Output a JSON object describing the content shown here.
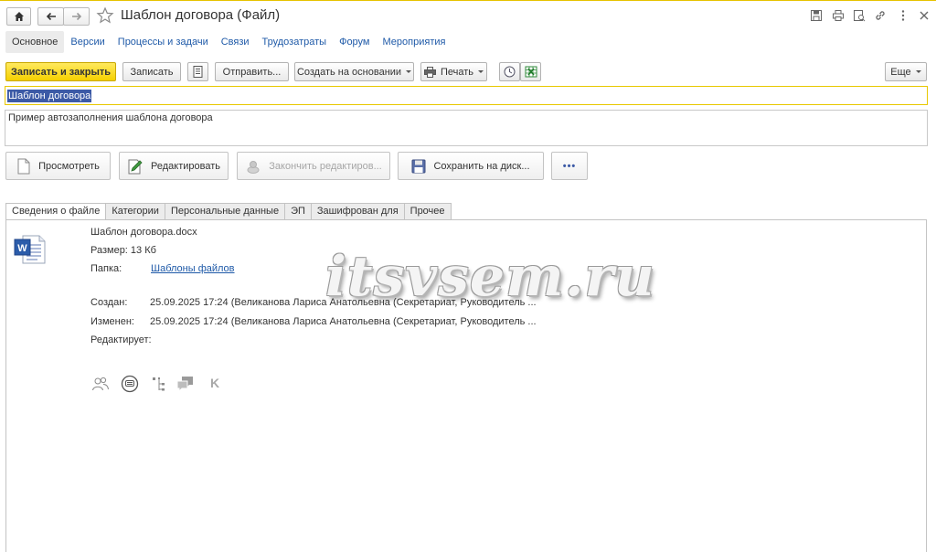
{
  "window": {
    "title": "Шаблон договора (Файл)"
  },
  "form_tabs": [
    {
      "label": "Основное",
      "active": true
    },
    {
      "label": "Версии"
    },
    {
      "label": "Процессы и задачи"
    },
    {
      "label": "Связи"
    },
    {
      "label": "Трудозатраты"
    },
    {
      "label": "Форум"
    },
    {
      "label": "Мероприятия"
    }
  ],
  "toolbar": {
    "save_close": "Записать и закрыть",
    "save": "Записать",
    "send": "Отправить...",
    "create_based": "Создать на основании",
    "print": "Печать",
    "more": "Еще"
  },
  "fields": {
    "name": "Шаблон договора",
    "description": "Пример автозаполнения шаблона договора"
  },
  "actions": {
    "view": "Просмотреть",
    "edit": "Редактировать",
    "finish_edit": "Закончить редактиров...",
    "save_to_disk": "Сохранить на диск...",
    "dots": "•••"
  },
  "tabs": [
    {
      "label": "Сведения о файле",
      "active": true
    },
    {
      "label": "Категории"
    },
    {
      "label": "Персональные данные"
    },
    {
      "label": "ЭП"
    },
    {
      "label": "Зашифрован для"
    },
    {
      "label": "Прочее"
    }
  ],
  "file_info": {
    "filename": "Шаблон договора.docx",
    "size": "Размер: 13 Кб",
    "folder_label": "Папка:",
    "folder_value": "Шаблоны файлов",
    "created_label": "Создан:",
    "created_value": "25.09.2025 17:24 (Великанова Лариса Анатольевна (Секретариат, Руководитель ...",
    "modified_label": "Изменен:",
    "modified_value": "25.09.2025 17:24 (Великанова Лариса Анатольевна (Секретариат, Руководитель ...",
    "editing_label": "Редактирует:",
    "file_icon": "word-document-icon"
  },
  "bottom_icons": [
    "users-icon",
    "comment-circle-icon",
    "tree-icon",
    "chat-bubbles-icon",
    "k-letter-icon"
  ],
  "bottom_k": "K",
  "watermark": "itsvsem.ru",
  "colors": {
    "accent": "#f5d000",
    "link": "#1f5aa8",
    "selection": "#3c5aa6"
  }
}
